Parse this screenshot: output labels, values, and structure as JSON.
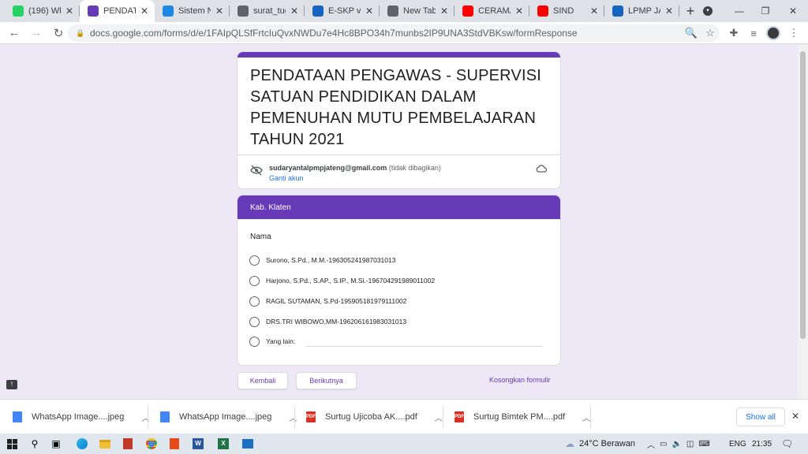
{
  "browser": {
    "tabs": [
      {
        "label": "(196) Wh",
        "icon": "whatsapp-icon",
        "color": "#25d366",
        "active": false
      },
      {
        "label": "PENDATA",
        "icon": "google-forms-icon",
        "color": "#673ab7",
        "active": true
      },
      {
        "label": "Sistem N",
        "icon": "mail-icon",
        "color": "#1e88e5",
        "active": false
      },
      {
        "label": "surat_tug",
        "icon": "globe-icon",
        "color": "#5f6368",
        "active": false
      },
      {
        "label": "E-SKP v.2",
        "icon": "eskp-icon",
        "color": "#1565c0",
        "active": false
      },
      {
        "label": "New Tab",
        "icon": "globe-icon",
        "color": "#5f6368",
        "active": false
      },
      {
        "label": "CERAMA",
        "icon": "youtube-icon",
        "color": "#ff0000",
        "active": false
      },
      {
        "label": "SIND",
        "icon": "youtube-icon",
        "color": "#ff0000",
        "active": false
      },
      {
        "label": "LPMP JA",
        "icon": "lpmp-icon",
        "color": "#1565c0",
        "active": false
      }
    ],
    "url": "docs.google.com/forms/d/e/1FAIpQLSfFrtcIuQvxNWDu7e4Hc8BPO34h7munbs2IP9UNA3StdVBKsw/formResponse"
  },
  "form": {
    "title": "PENDATAAN PENGAWAS - SUPERVISI SATUAN PENDIDIKAN DALAM PEMENUHAN MUTU PEMBELAJARAN TAHUN 2021",
    "account_email": "sudaryantalpmpjateng@gmail.com",
    "account_note": "(tidak dibagikan)",
    "switch_account": "Ganti akun",
    "section_title": "Kab. Klaten",
    "question": "Nama",
    "options": [
      "Surono, S.Pd., M.M.-196305241987031013",
      "Harjono, S.Pd., S.AP., S.IP., M.Si.-196704291989011002",
      "RAGIL SUTAMAN, S.Pd-195905181979111002",
      "DRS.TRI WIBOWO,MM-196206161983031013"
    ],
    "other_label": "Yang lain:",
    "back_button": "Kembali",
    "next_button": "Berikutnya",
    "clear_link": "Kosongkan formulir",
    "theme_color": "#673ab7"
  },
  "downloads": {
    "items": [
      {
        "name": "WhatsApp Image....jpeg",
        "type": "image"
      },
      {
        "name": "WhatsApp Image....jpeg",
        "type": "image"
      },
      {
        "name": "Surtug Ujicoba AK....pdf",
        "type": "pdf"
      },
      {
        "name": "Surtug Bimtek PM....pdf",
        "type": "pdf"
      }
    ],
    "show_all": "Show all"
  },
  "taskbar": {
    "weather": "24°C  Berawan",
    "language": "ENG",
    "time": "21:35"
  }
}
